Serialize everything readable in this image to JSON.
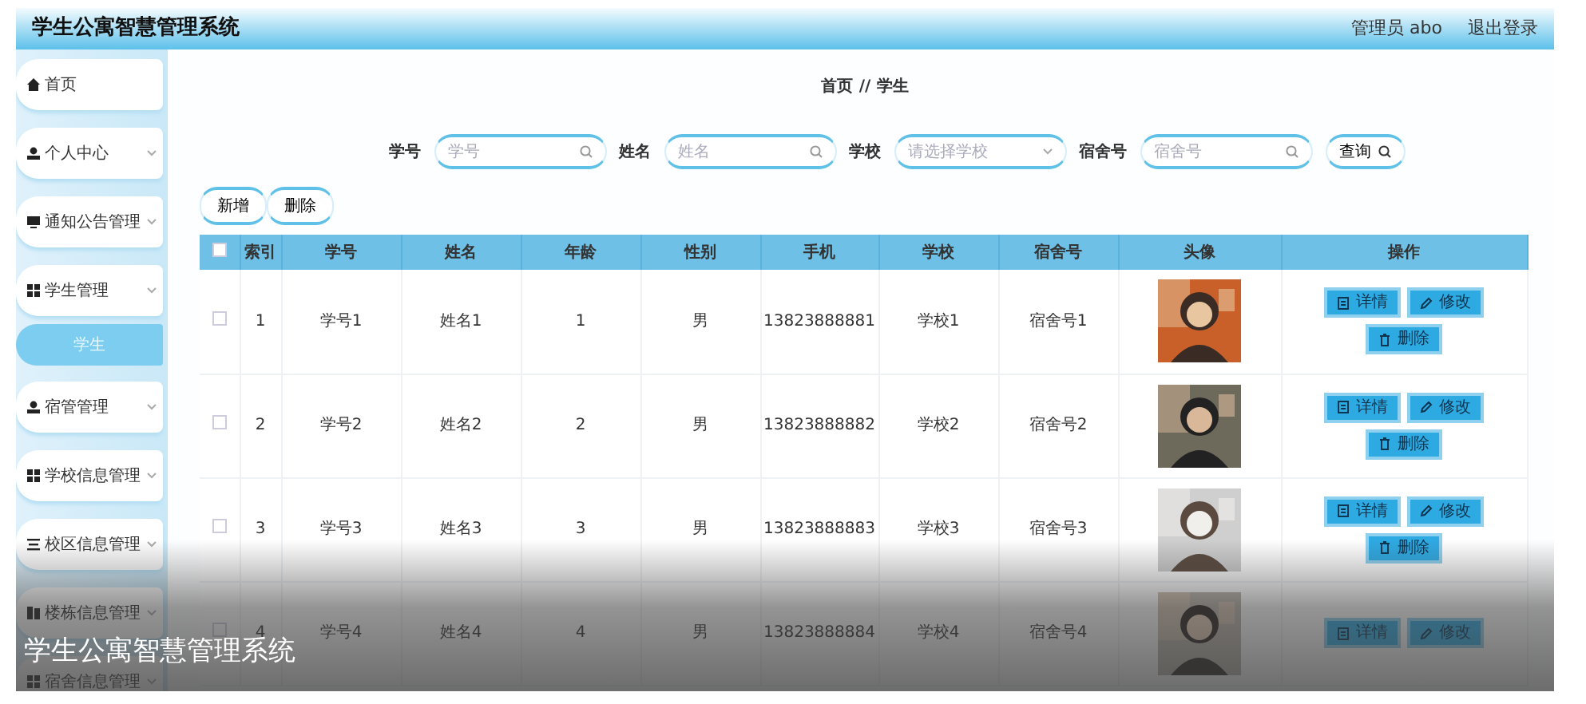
{
  "header": {
    "title": "学生公寓智慧管理系统",
    "user": "管理员 abo",
    "logout": "退出登录"
  },
  "sidebar": {
    "items": [
      {
        "label": "首页",
        "expandable": false
      },
      {
        "label": "个人中心",
        "expandable": true
      },
      {
        "label": "通知公告管理",
        "expandable": true
      },
      {
        "label": "学生管理",
        "expandable": true,
        "children": [
          {
            "label": "学生",
            "selected": true
          }
        ]
      },
      {
        "label": "宿管管理",
        "expandable": true
      },
      {
        "label": "学校信息管理",
        "expandable": true
      },
      {
        "label": "校区信息管理",
        "expandable": true
      },
      {
        "label": "楼栋信息管理",
        "expandable": true
      },
      {
        "label": "宿舍信息管理",
        "expandable": true
      }
    ]
  },
  "breadcrumb": {
    "items": [
      "首页",
      "学生"
    ],
    "separator": "//"
  },
  "search": {
    "fields": [
      {
        "label": "学号",
        "placeholder": "学号",
        "kind": "text"
      },
      {
        "label": "姓名",
        "placeholder": "姓名",
        "kind": "text"
      },
      {
        "label": "学校",
        "placeholder": "请选择学校",
        "kind": "select"
      },
      {
        "label": "宿舍号",
        "placeholder": "宿舍号",
        "kind": "text"
      }
    ],
    "button": "查询"
  },
  "toolbar": [
    "新增",
    "删除"
  ],
  "table": {
    "header_checked": false,
    "columns": [
      "索引",
      "学号",
      "姓名",
      "年龄",
      "性别",
      "手机",
      "学校",
      "宿舍号",
      "头像",
      "操作"
    ],
    "rows": [
      {
        "checked": false,
        "cells": [
          "1",
          "学号1",
          "姓名1",
          "1",
          "男",
          "13823888881",
          "学校1",
          "宿舍号1"
        ],
        "avatar": {
          "kind": "picture"
        },
        "actions": [
          "详情",
          "修改",
          "删除"
        ]
      },
      {
        "checked": false,
        "cells": [
          "2",
          "学号2",
          "姓名2",
          "2",
          "男",
          "13823888882",
          "学校2",
          "宿舍号2"
        ],
        "avatar": {
          "kind": "picture"
        },
        "actions": [
          "详情",
          "修改",
          "删除"
        ]
      },
      {
        "checked": false,
        "cells": [
          "3",
          "学号3",
          "姓名3",
          "3",
          "男",
          "13823888883",
          "学校3",
          "宿舍号3"
        ],
        "avatar": {
          "kind": "picture"
        },
        "actions": [
          "详情",
          "修改",
          "删除"
        ]
      },
      {
        "checked": false,
        "cells": [
          "4",
          "学号4",
          "姓名4",
          "4",
          "男",
          "13823888884",
          "学校4",
          "宿舍号4"
        ],
        "avatar": {
          "kind": "picture"
        },
        "actions": [
          "详情",
          "修改"
        ]
      }
    ]
  },
  "caption": "学生公寓智慧管理系统"
}
